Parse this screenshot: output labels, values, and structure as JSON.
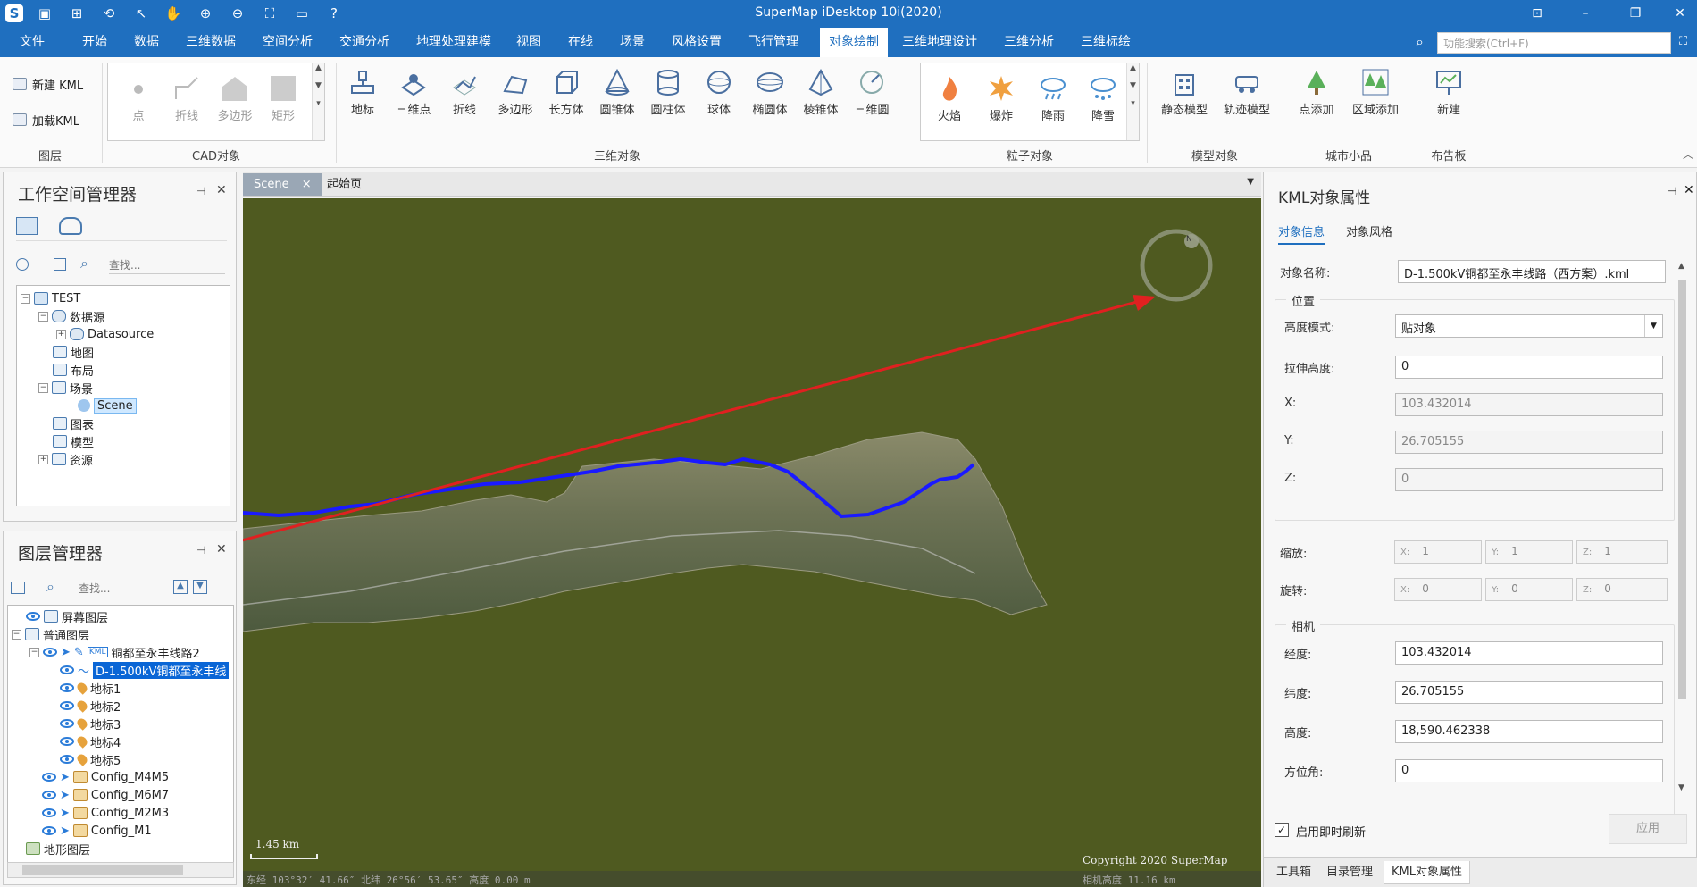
{
  "app": {
    "title": "SuperMap iDesktop 10i(2020)"
  },
  "menu": {
    "items": [
      "文件",
      "开始",
      "数据",
      "三维数据",
      "空间分析",
      "交通分析",
      "地理处理建模",
      "视图",
      "在线",
      "场景",
      "风格设置",
      "飞行管理",
      "对象绘制",
      "三维地理设计",
      "三维分析",
      "三维标绘"
    ],
    "active_index": 12,
    "search_placeholder": "功能搜索(Ctrl+F)"
  },
  "ribbon": {
    "layer_group": {
      "new_kml": "新建 KML",
      "load_kml": "加载KML",
      "label": "图层"
    },
    "cad_group": {
      "items": [
        "点",
        "折线",
        "多边形",
        "矩形"
      ],
      "label": "CAD对象"
    },
    "obj3d_group": {
      "items": [
        "地标",
        "三维点",
        "折线",
        "多边形",
        "长方体",
        "圆锥体",
        "圆柱体",
        "球体",
        "椭圆体",
        "棱锥体",
        "三维圆"
      ],
      "label": "三维对象"
    },
    "particle_group": {
      "items": [
        "火焰",
        "爆炸",
        "降雨",
        "降雪"
      ],
      "label": "粒子对象"
    },
    "model_group": {
      "items": [
        "静态模型",
        "轨迹模型"
      ],
      "label": "模型对象"
    },
    "city_group": {
      "items": [
        "点添加",
        "区域添加"
      ],
      "label": "城市小品"
    },
    "board_group": {
      "items": [
        "新建"
      ],
      "label": "布告板"
    }
  },
  "workspace": {
    "title": "工作空间管理器",
    "search_placeholder": "查找...",
    "tree": [
      {
        "label": "TEST",
        "level": 0,
        "expander": "−"
      },
      {
        "label": "数据源",
        "level": 1,
        "expander": "−"
      },
      {
        "label": "Datasource",
        "level": 2,
        "expander": "+"
      },
      {
        "label": "地图",
        "level": 1,
        "expander": ""
      },
      {
        "label": "布局",
        "level": 1,
        "expander": ""
      },
      {
        "label": "场景",
        "level": 1,
        "expander": "−"
      },
      {
        "label": "Scene",
        "level": 2,
        "expander": "",
        "selected": true
      },
      {
        "label": "图表",
        "level": 1,
        "expander": ""
      },
      {
        "label": "模型",
        "level": 1,
        "expander": ""
      },
      {
        "label": "资源",
        "level": 1,
        "expander": "+"
      }
    ]
  },
  "layers": {
    "title": "图层管理器",
    "search_placeholder": "查找...",
    "tree": [
      {
        "label": "屏幕图层",
        "level": 0,
        "expander": ""
      },
      {
        "label": "普通图层",
        "level": 0,
        "expander": "−"
      },
      {
        "label": "铜都至永丰线路2",
        "level": 1,
        "expander": "−",
        "kml_tag": "KML"
      },
      {
        "label": "D-1.500kV铜都至永丰线",
        "level": 2,
        "expander": "",
        "selected": true
      },
      {
        "label": "地标1",
        "level": 2,
        "expander": ""
      },
      {
        "label": "地标2",
        "level": 2,
        "expander": ""
      },
      {
        "label": "地标3",
        "level": 2,
        "expander": ""
      },
      {
        "label": "地标4",
        "level": 2,
        "expander": ""
      },
      {
        "label": "地标5",
        "level": 2,
        "expander": ""
      },
      {
        "label": "Config_M4M5",
        "level": 1,
        "expander": ""
      },
      {
        "label": "Config_M6M7",
        "level": 1,
        "expander": ""
      },
      {
        "label": "Config_M2M3",
        "level": 1,
        "expander": ""
      },
      {
        "label": "Config_M1",
        "level": 1,
        "expander": ""
      },
      {
        "label": "地形图层",
        "level": 0,
        "expander": ""
      }
    ]
  },
  "doc_tabs": {
    "tabs": [
      "Scene",
      "起始页"
    ],
    "close": "×",
    "active_index": 0
  },
  "scene": {
    "scale_label": "1.45 km",
    "status": "东经 103°32′ 41.66″  北纬 26°56′ 53.65″  高度 0.00 m",
    "copyright": "Copyright 2020 SuperMap",
    "camera_height": "相机高度 11.16 km",
    "compass": "N"
  },
  "props": {
    "title": "KML对象属性",
    "tabs": [
      "对象信息",
      "对象风格"
    ],
    "name_label": "对象名称:",
    "name_value": "D-1.500kV铜都至永丰线路（西方案）.kml",
    "position_title": "位置",
    "height_mode_label": "高度模式:",
    "height_mode_value": "贴对象",
    "extrude_label": "拉伸高度:",
    "extrude_value": "0",
    "x_label": "X:",
    "x_value": "103.432014",
    "y_label": "Y:",
    "y_value": "26.705155",
    "z_label": "Z:",
    "z_value": "0",
    "scale_label": "缩放:",
    "scale_values": [
      "1",
      "1",
      "1"
    ],
    "rotate_label": "旋转:",
    "rotate_values": [
      "0",
      "0",
      "0"
    ],
    "axis_labels": [
      "X:",
      "Y:",
      "Z:"
    ],
    "camera_title": "相机",
    "lon_label": "经度:",
    "lon_value": "103.432014",
    "lat_label": "纬度:",
    "lat_value": "26.705155",
    "alt_label": "高度:",
    "alt_value": "18,590.462338",
    "azimuth_label": "方位角:",
    "azimuth_value": "0",
    "realtime_label": "启用即时刷新",
    "apply_label": "应用"
  },
  "bottom_tabs": [
    "工具箱",
    "目录管理",
    "KML对象属性"
  ],
  "colors": {
    "accent": "#1f6fbf",
    "route": "#1a1aff",
    "arrow": "#e02020",
    "terrain_bg": "#4f5a20"
  }
}
